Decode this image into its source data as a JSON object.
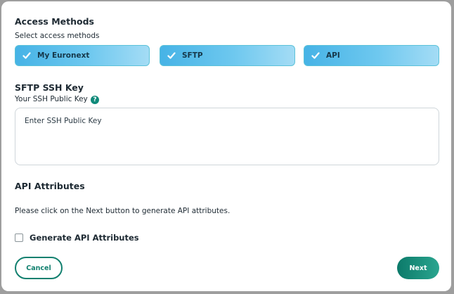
{
  "access_methods": {
    "title": "Access Methods",
    "subtitle": "Select access methods",
    "options": [
      {
        "label": "My Euronext",
        "checked": true
      },
      {
        "label": "SFTP",
        "checked": true
      },
      {
        "label": "API",
        "checked": true
      }
    ]
  },
  "sftp": {
    "title": "SFTP SSH Key",
    "label": "Your SSH Public Key",
    "help_glyph": "?",
    "placeholder": "Enter SSH Public Key"
  },
  "api": {
    "title": "API Attributes",
    "description": "Please click on the Next button to generate API attributes.",
    "generate_label": "Generate API Attributes",
    "generate_checked": false
  },
  "buttons": {
    "cancel": "Cancel",
    "next": "Next"
  },
  "colors": {
    "accent": "#12806f",
    "method_bg": "#6ec8ef"
  }
}
